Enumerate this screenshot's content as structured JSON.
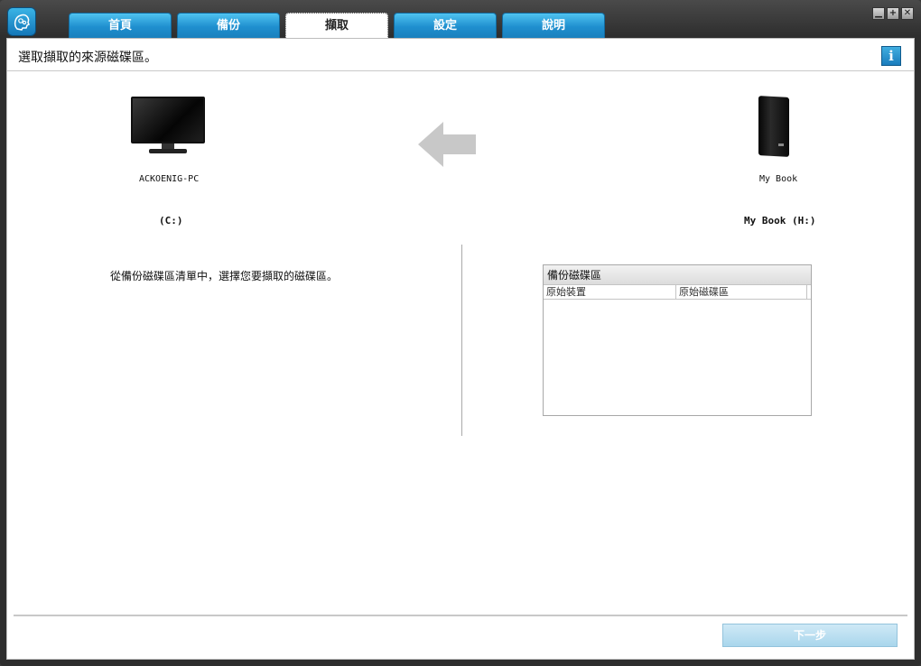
{
  "window": {
    "controls": [
      "▁",
      "+",
      "✕"
    ]
  },
  "tabs": [
    {
      "label": "首頁",
      "active": false
    },
    {
      "label": "備份",
      "active": false
    },
    {
      "label": "擷取",
      "active": true
    },
    {
      "label": "設定",
      "active": false
    },
    {
      "label": "說明",
      "active": false
    }
  ],
  "header": {
    "text": "選取擷取的來源磁碟區。",
    "info_icon": "i"
  },
  "source": {
    "device_name": "ACKOENIG-PC",
    "volume": "(C:)"
  },
  "target": {
    "device_name": "My Book",
    "volume": "My Book (H:)"
  },
  "instruction": "從備份磁碟區清單中，選擇您要擷取的磁碟區。",
  "listbox": {
    "title": "備份磁碟區",
    "columns": [
      "原始裝置",
      "原始磁碟區"
    ]
  },
  "footer": {
    "next_label": "下一步"
  },
  "colors": {
    "tab_blue": "#1f8fcf",
    "accent": "#40aee0"
  }
}
